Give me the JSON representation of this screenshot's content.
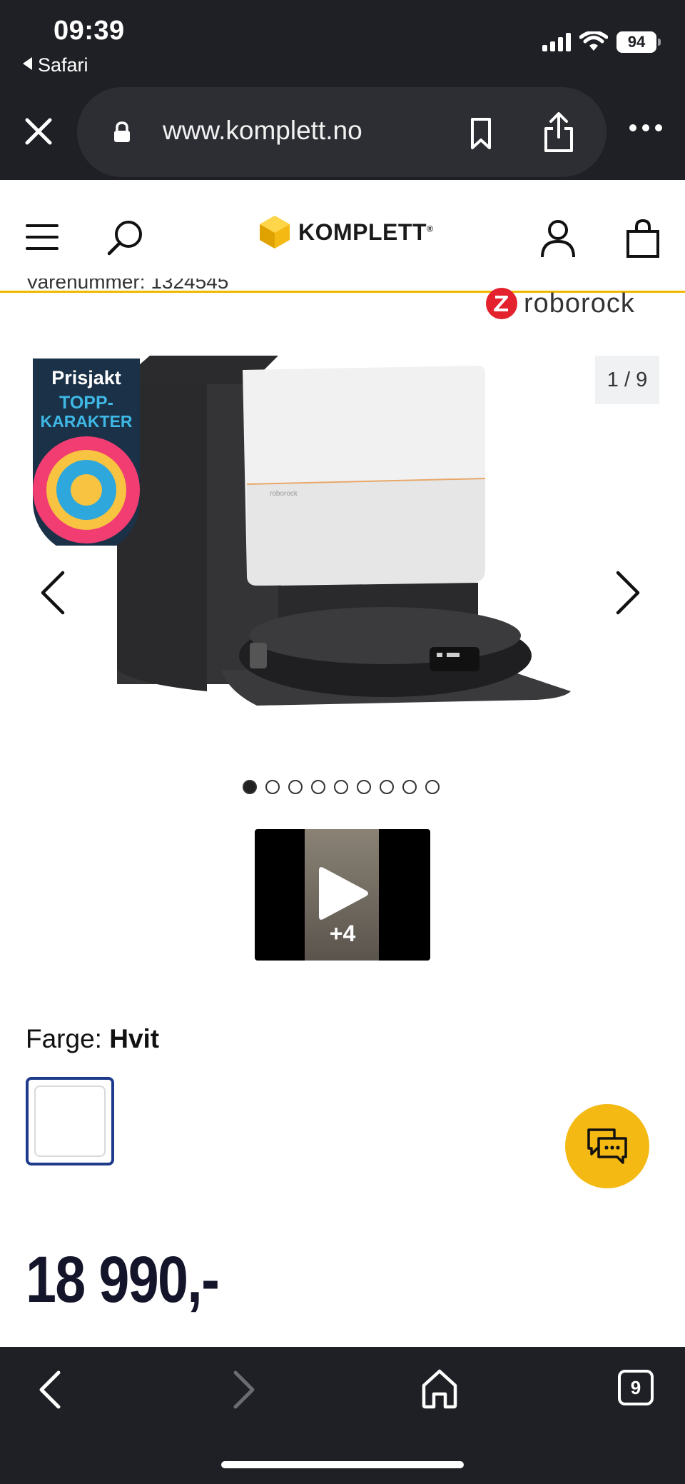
{
  "status_bar": {
    "time": "09:39",
    "back_app": "Safari",
    "battery": "94"
  },
  "browser": {
    "url": "www.komplett.no",
    "tab_count": "9"
  },
  "site": {
    "logo_text": "KOMPLETT",
    "logo_mark": "®",
    "brand_color": "#f2b800"
  },
  "product": {
    "sku_partial": "Varenummer: 1324545",
    "brand": "roborock",
    "image_counter": "1 / 9",
    "image_count": 9,
    "active_image": 1,
    "badge": {
      "line1": "Prisjakt",
      "line2": "TOPP-",
      "line3": "KARAKTER"
    },
    "video_more": "+4",
    "color_label": "Farge:",
    "color_value": "Hvit",
    "price": "18 990,-"
  },
  "icons": {
    "close": "close-icon",
    "lock": "lock-icon",
    "bookmark": "bookmark-icon",
    "share": "share-icon",
    "more": "more-icon",
    "menu": "hamburger-icon",
    "search": "search-icon",
    "account": "user-icon",
    "cart": "shopping-bag-icon",
    "chat": "chat-icon",
    "home": "home-icon"
  }
}
